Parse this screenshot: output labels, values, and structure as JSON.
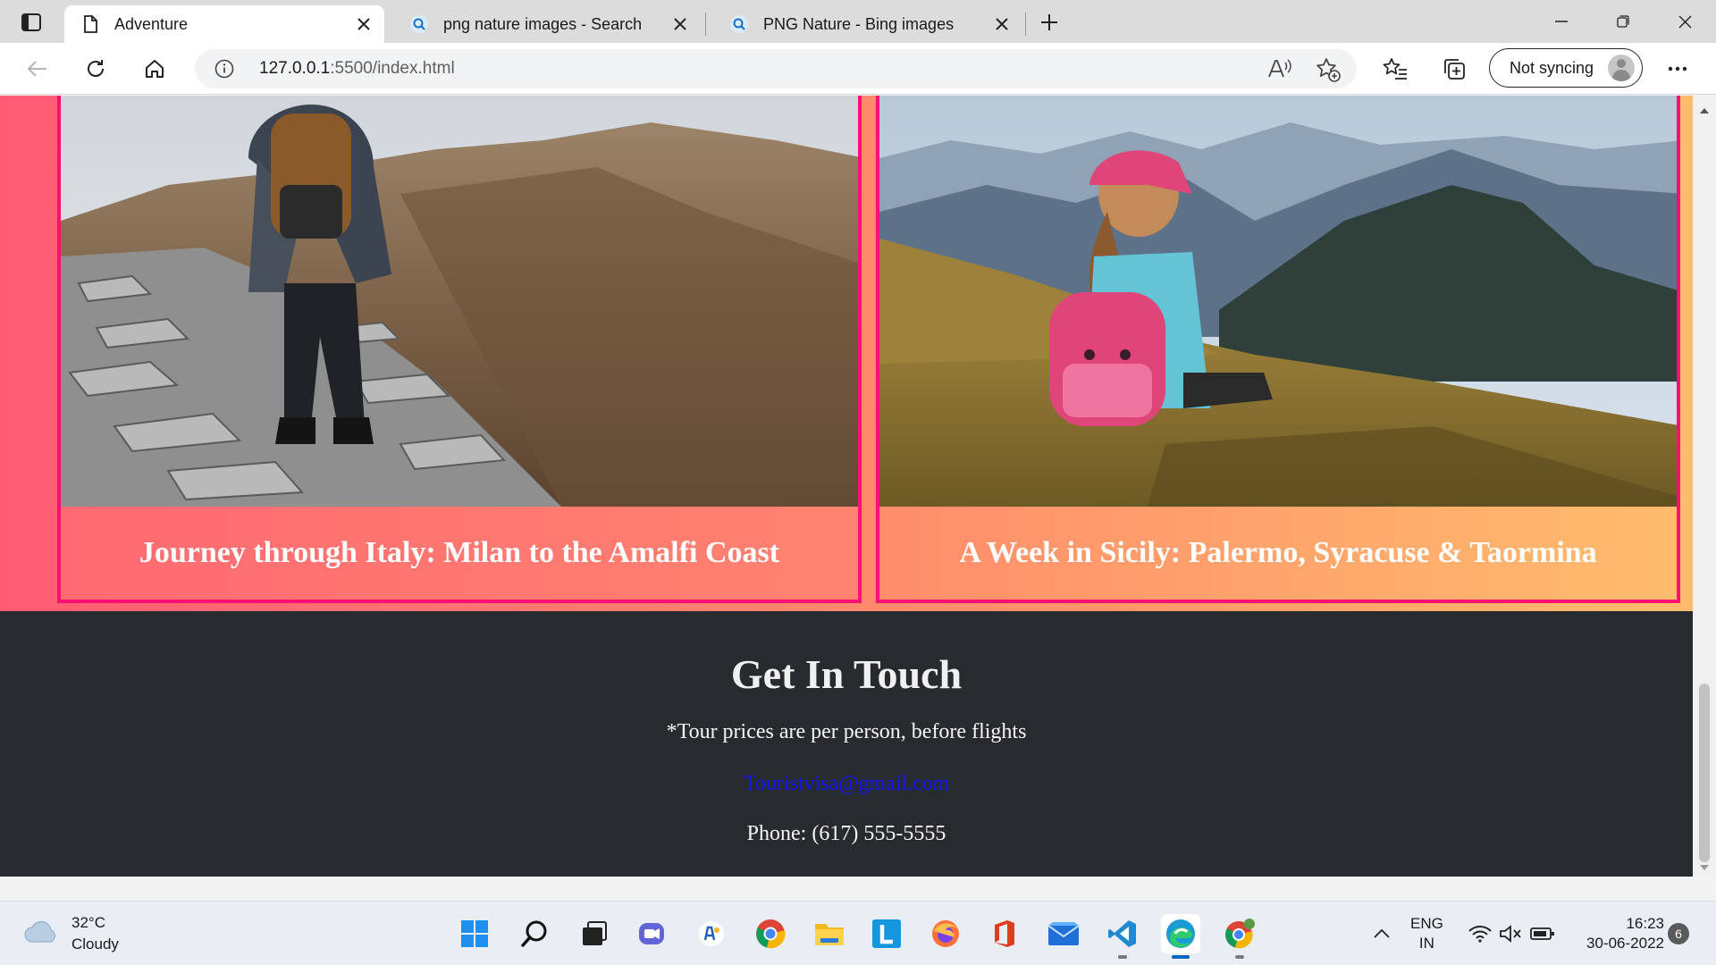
{
  "browser": {
    "tabs": [
      {
        "title": "Adventure",
        "icon": "page-icon",
        "active": true
      },
      {
        "title": "png nature images - Search",
        "icon": "bing-search-icon",
        "active": false
      },
      {
        "title": "PNG Nature - Bing images",
        "icon": "bing-search-icon",
        "active": false
      }
    ],
    "address": {
      "host": "127.0.0.1",
      "rest": ":5500/index.html"
    },
    "sync_label": "Not syncing"
  },
  "page": {
    "cards": [
      {
        "caption": "Journey through Italy: Milan to the Amalfi Coast",
        "image": "hiker-on-rocky-trail-photo"
      },
      {
        "caption": "A Week in Sicily: Palermo, Syracuse & Taormina",
        "image": "girl-on-mountain-meadow-photo"
      }
    ],
    "contact": {
      "heading": "Get In Touch",
      "note": "*Tour prices are per person, before flights",
      "email": "Touristvisa@gmail.com",
      "phone": "Phone: (617) 555-5555"
    }
  },
  "taskbar": {
    "weather": {
      "temp": "32°C",
      "condition": "Cloudy"
    },
    "apps": [
      "windows-start-icon",
      "search-icon",
      "task-view-icon",
      "teams-chat-icon",
      "widgets-app-icon",
      "chrome-icon",
      "file-explorer-icon",
      "launcher-l-icon",
      "firefox-icon",
      "office-icon",
      "mail-icon",
      "vscode-icon",
      "edge-icon",
      "chrome-canary-icon"
    ],
    "lang": {
      "line1": "ENG",
      "line2": "IN"
    },
    "clock": {
      "time": "16:23",
      "date": "30-06-2022"
    },
    "notifications": "6"
  },
  "colors": {
    "accent_border": "#ff0e74",
    "gradient_start": "#ff5b75",
    "gradient_end": "#ffbd6c",
    "footer_bg": "#272b30",
    "email_link": "#1414ff"
  }
}
